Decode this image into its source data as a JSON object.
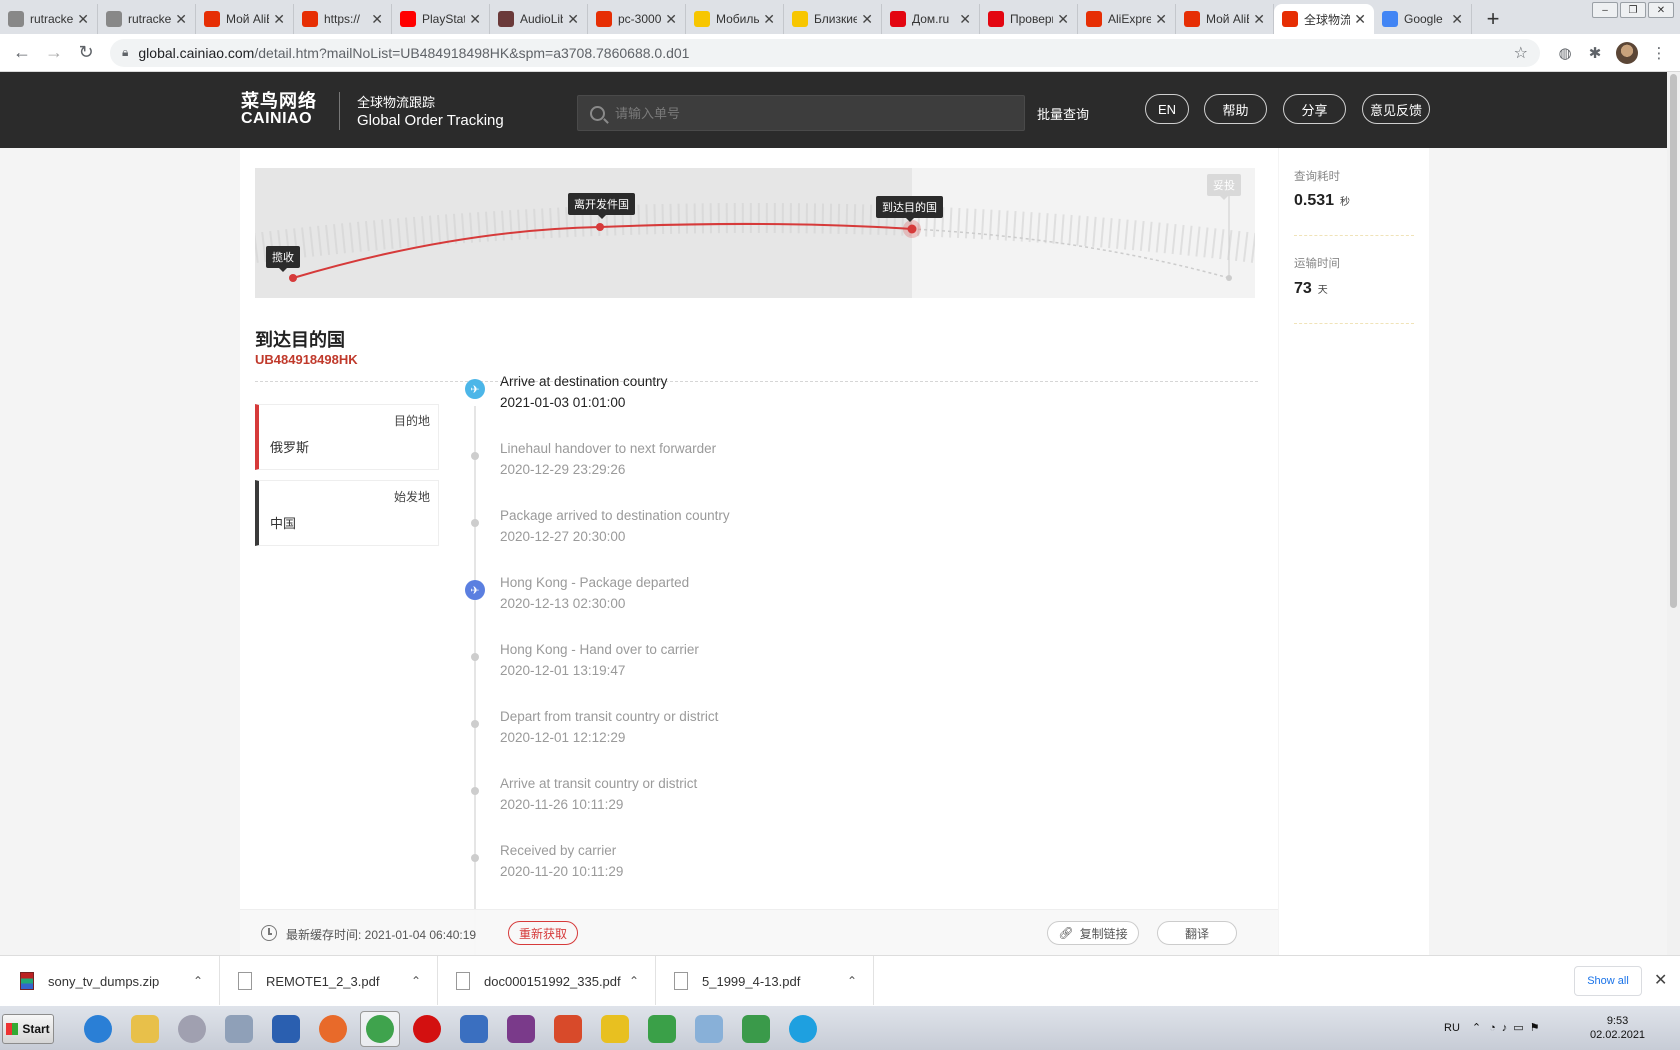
{
  "browser": {
    "tabs": [
      {
        "title": "rutracker",
        "color": "#888888"
      },
      {
        "title": "rutracker",
        "color": "#888888"
      },
      {
        "title": "Мой AliExpress",
        "color": "#e62e04"
      },
      {
        "title": "https://",
        "color": "#e62e04"
      },
      {
        "title": "PlayStation",
        "color": "#ff0000"
      },
      {
        "title": "AudioLib",
        "color": "#6b3a3a"
      },
      {
        "title": "pc-3000",
        "color": "#e62e04"
      },
      {
        "title": "Мобильный",
        "color": "#f7c600"
      },
      {
        "title": "Близкие",
        "color": "#f7c600"
      },
      {
        "title": "Дом.ru",
        "color": "#e30611"
      },
      {
        "title": "Проверка",
        "color": "#e30611"
      },
      {
        "title": "AliExpress",
        "color": "#e62e04"
      },
      {
        "title": "Мой AliExpress",
        "color": "#e62e04"
      },
      {
        "title": "全球物流",
        "color": "#e62e04",
        "active": true
      },
      {
        "title": "Google",
        "color": "#4285f4"
      }
    ],
    "url_host": "global.cainiao.com",
    "url_path": "/detail.htm?mailNoList=UB484918498HK&spm=a3708.7860688.0.d01"
  },
  "header": {
    "logo_cn": "菜鸟网络",
    "logo_en": "CAINIAO",
    "subtitle_cn": "全球物流跟踪",
    "subtitle_en": "Global Order Tracking",
    "search_placeholder": "请输入单号",
    "batch_query": "批量查询",
    "buttons": {
      "lang": "EN",
      "help": "帮助",
      "share": "分享",
      "feedback": "意见反馈"
    }
  },
  "map": {
    "progress": 0.657,
    "labels": {
      "pickup": "揽收",
      "depart": "离开发件国",
      "arrive": "到达目的国",
      "delivered": "妥投"
    }
  },
  "status": {
    "title": "到达目的国",
    "tracking_number": "UB484918498HK",
    "destination_label": "目的地",
    "destination_value": "俄罗斯",
    "origin_label": "始发地",
    "origin_value": "中国"
  },
  "events": [
    {
      "title": "Arrive at destination country",
      "date": "2021-01-03 01:01:00",
      "icon": "plane-arrive-icon"
    },
    {
      "title": "Linehaul handover to next forwarder",
      "date": "2020-12-29 23:29:26"
    },
    {
      "title": "Package arrived to destination country",
      "date": "2020-12-27 20:30:00"
    },
    {
      "title": "Hong Kong - Package departed",
      "date": "2020-12-13 02:30:00",
      "icon": "plane-depart-icon"
    },
    {
      "title": "Hong Kong - Hand over to carrier",
      "date": "2020-12-01 13:19:47"
    },
    {
      "title": "Depart from transit country or district",
      "date": "2020-12-01 12:12:29"
    },
    {
      "title": "Arrive at transit country or district",
      "date": "2020-11-26 10:11:29"
    },
    {
      "title": "Received by carrier",
      "date": "2020-11-20 10:11:29"
    }
  ],
  "footer": {
    "cache_text": "最新缓存时间: 2021-01-04 06:40:19",
    "refetch": "重新获取",
    "copy_link": "复制链接",
    "translate": "翻译"
  },
  "stats": {
    "query_time_label": "查询耗时",
    "query_time_value": "0.531",
    "query_time_unit": "秒",
    "transit_label": "运输时间",
    "transit_value": "73",
    "transit_unit": "天"
  },
  "downloads": {
    "items": [
      "sony_tv_dumps.zip",
      "REMOTE1_2_3.pdf",
      "doc000151992_335.pdf",
      "5_1999_4-13.pdf"
    ],
    "show_all": "Show all"
  },
  "taskbar": {
    "start": "Start",
    "lang": "RU",
    "time": "9:53",
    "date": "02.02.2021"
  },
  "colors": {
    "accent": "#d63a3a",
    "header_bg": "#2b2b2b",
    "route_line": "#d63a3a"
  }
}
